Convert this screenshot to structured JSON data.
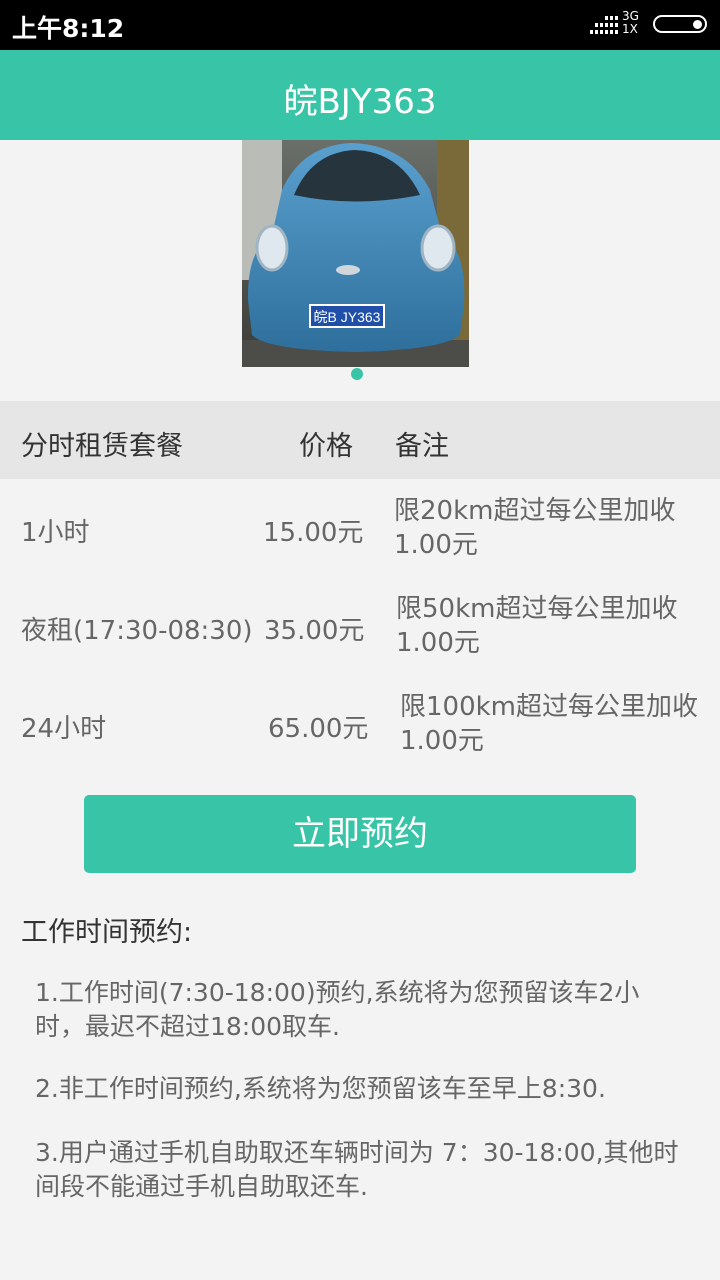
{
  "status": {
    "time": "上午8:12",
    "network": "3G",
    "sim": "1X"
  },
  "header": {
    "title": "皖BJY363"
  },
  "carousel": {
    "plate": "皖B JY363",
    "image_icon": "car-photo"
  },
  "table": {
    "headers": [
      "分时租赁套餐",
      "价格",
      "备注"
    ],
    "rows": [
      {
        "package": "1小时",
        "price": "15.00元",
        "note_line1": "限20km超过每公里加收",
        "note_line2": "1.00元"
      },
      {
        "package": "夜租(17:30-08:30)",
        "price": "35.00元",
        "note_line1": "限50km超过每公里加收",
        "note_line2": "1.00元"
      },
      {
        "package": "24小时",
        "price": "65.00元",
        "note_line1": "限100km超过每公里加收",
        "note_line2": "1.00元"
      }
    ]
  },
  "actions": {
    "book_now": "立即预约"
  },
  "rules": {
    "title": "工作时间预约:",
    "items": [
      "1.工作时间(7:30-18:00)预约,系统将为您预留该车2小时，最迟不超过18:00取车.",
      "2.非工作时间预约,系统将为您预留该车至早上8:30.",
      "3.用户通过手机自助取还车辆时间为 7：30-18:00,其他时间段不能通过手机自助取还车."
    ]
  },
  "colors": {
    "accent": "#38c4a7",
    "header_bg": "#e6e6e6",
    "page_bg": "#f3f3f3"
  }
}
